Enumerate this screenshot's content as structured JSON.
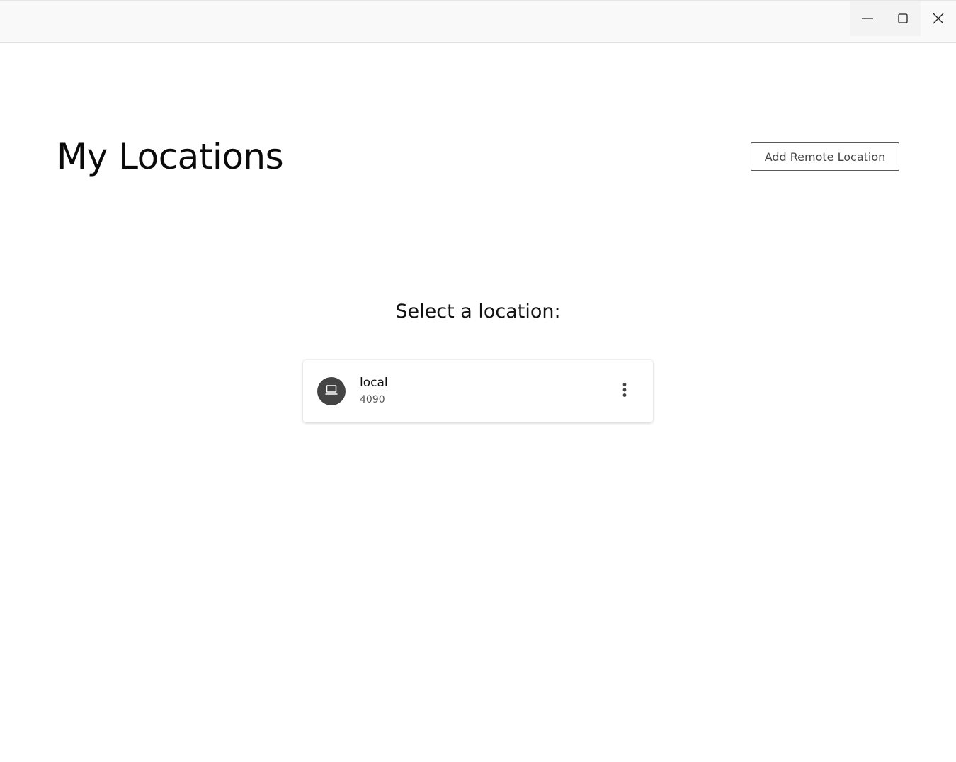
{
  "window": {
    "controls": {
      "minimize_icon": "minimize-icon",
      "maximize_icon": "maximize-icon",
      "close_icon": "close-icon"
    }
  },
  "header": {
    "title": "My Locations",
    "add_button_label": "Add Remote Location"
  },
  "main": {
    "prompt": "Select a location:",
    "locations": [
      {
        "name": "local",
        "detail": "4090",
        "icon": "laptop-icon",
        "menu_icon": "more-vertical-icon"
      }
    ]
  },
  "colors": {
    "titlebar_bg": "#f9f9f9",
    "avatar_bg": "#444444",
    "text_primary": "#111111",
    "text_secondary": "#555555",
    "button_border": "#5a5a5a"
  }
}
